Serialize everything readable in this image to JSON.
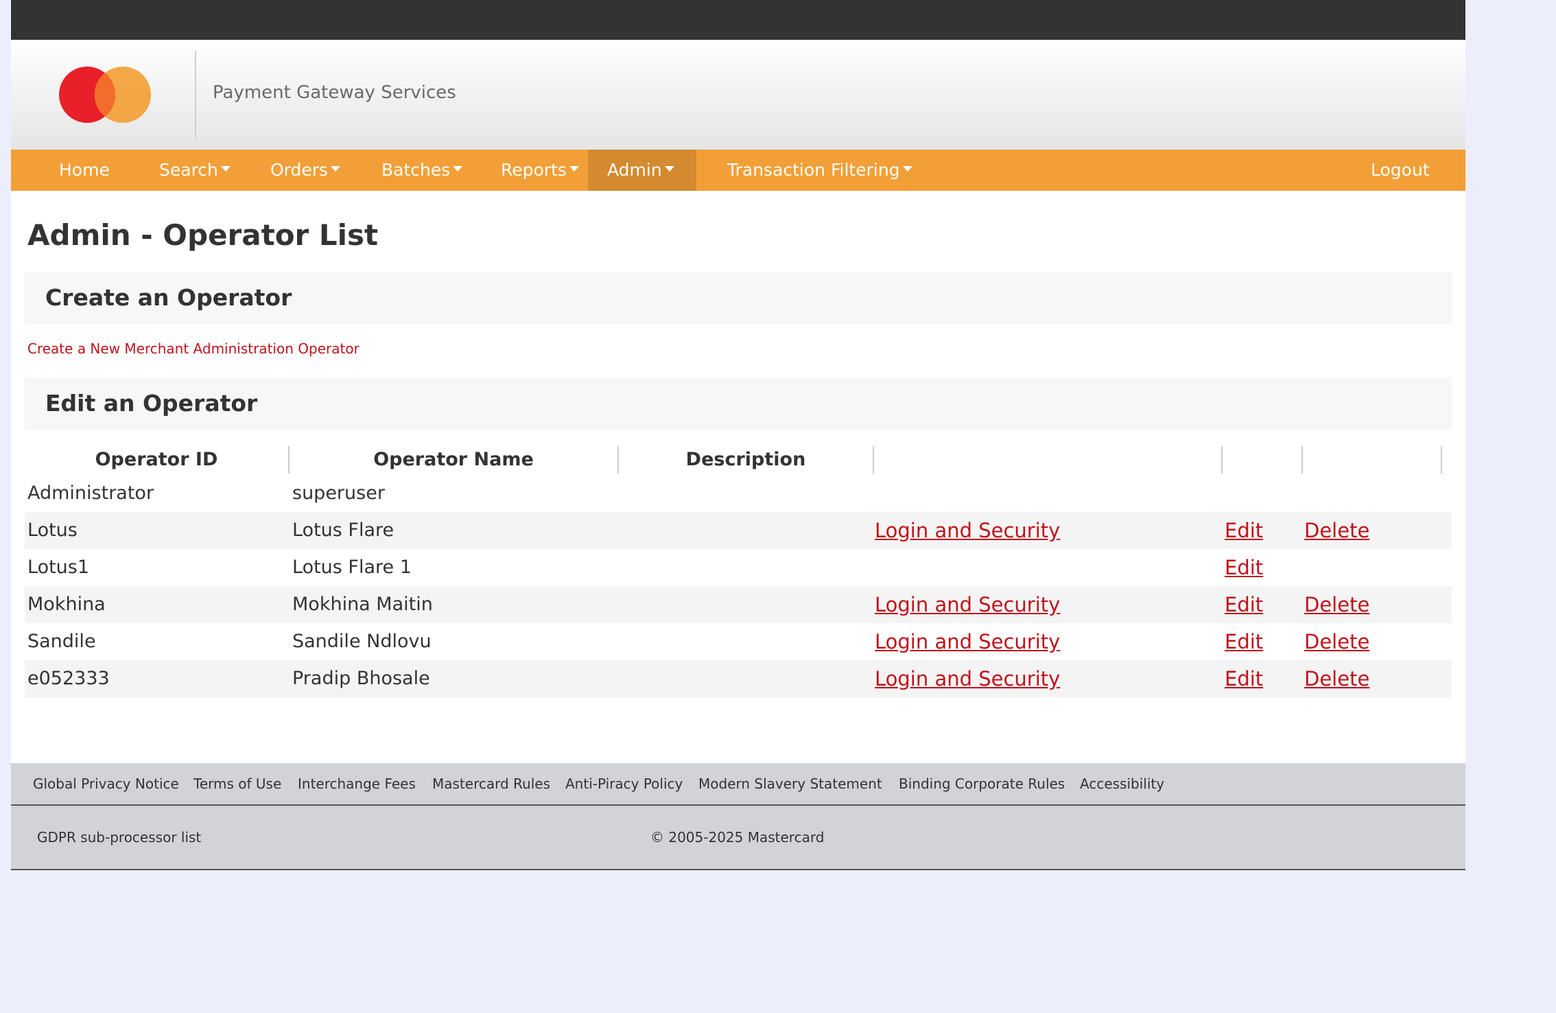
{
  "header": {
    "brand_text": "Payment Gateway Services",
    "logo_icon": "mastercard-logo-icon",
    "colors": {
      "logo_red": "#e8202a",
      "logo_orange": "#f29f37",
      "logo_overlap": "#f26d2b"
    }
  },
  "nav": {
    "items": [
      {
        "label": "Home",
        "dropdown": false
      },
      {
        "label": "Search",
        "dropdown": true
      },
      {
        "label": "Orders",
        "dropdown": true
      },
      {
        "label": "Batches",
        "dropdown": true
      },
      {
        "label": "Reports",
        "dropdown": true
      },
      {
        "label": "Admin",
        "dropdown": true,
        "active": true
      },
      {
        "label": "Transaction Filtering",
        "dropdown": true
      }
    ],
    "logout_label": "Logout",
    "colors": {
      "bar": "#f29f37",
      "active": "#d48a2e"
    }
  },
  "page": {
    "title": "Admin - Operator List"
  },
  "create_section": {
    "heading": "Create an Operator",
    "link_label": "Create a New Merchant Administration Operator"
  },
  "edit_section": {
    "heading": "Edit an Operator",
    "table": {
      "headers": [
        "Operator ID",
        "Operator Name",
        "Description",
        "",
        "",
        ""
      ],
      "rows": [
        {
          "id": "Administrator",
          "name": "superuser",
          "description": "",
          "security": "",
          "edit": "",
          "delete": ""
        },
        {
          "id": "Lotus",
          "name": "Lotus Flare",
          "description": "",
          "security": "Login and Security",
          "edit": "Edit",
          "delete": "Delete"
        },
        {
          "id": "Lotus1",
          "name": "Lotus Flare 1",
          "description": "",
          "security": "",
          "edit": "Edit",
          "delete": ""
        },
        {
          "id": "Mokhina",
          "name": "Mokhina Maitin",
          "description": "",
          "security": "Login and Security",
          "edit": "Edit",
          "delete": "Delete"
        },
        {
          "id": "Sandile",
          "name": "Sandile Ndlovu",
          "description": "",
          "security": "Login and Security",
          "edit": "Edit",
          "delete": "Delete"
        },
        {
          "id": "e052333",
          "name": "Pradip Bhosale",
          "description": "",
          "security": "Login and Security",
          "edit": "Edit",
          "delete": "Delete"
        }
      ]
    },
    "colors": {
      "link": "#c0121a"
    }
  },
  "footer": {
    "links": [
      "Global Privacy Notice",
      "Terms of Use",
      "Interchange Fees",
      "Mastercard Rules",
      "Anti-Piracy Policy",
      "Modern Slavery Statement",
      "Binding Corporate Rules",
      "Accessibility"
    ],
    "gdpr_label": "GDPR sub-processor list",
    "copyright": "© 2005-2025 Mastercard"
  }
}
